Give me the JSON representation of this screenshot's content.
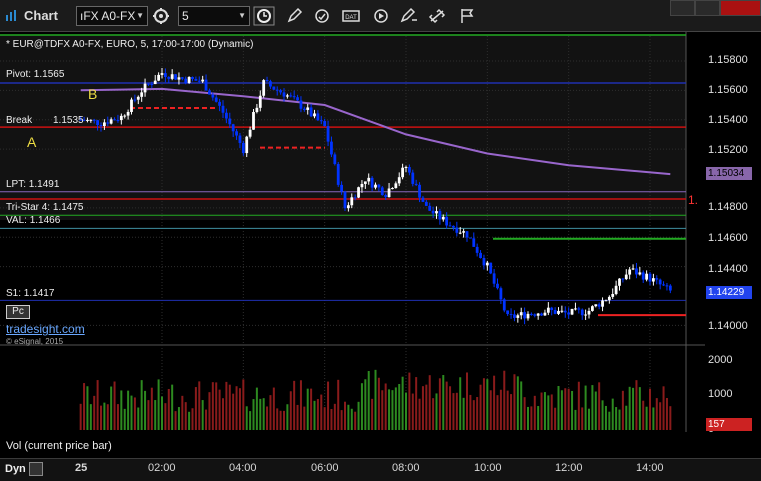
{
  "window": {
    "title": "Chart"
  },
  "toolbar": {
    "symbol": "ıFX A0-FX",
    "interval": "5"
  },
  "chart_header": "* EUR@TDFX A0-FX, EURO, 5, 17:00-17:00 (Dynamic)",
  "price_axis": {
    "ticks": [
      "1.15800",
      "1.15600",
      "1.15400",
      "1.15200",
      "1.14800",
      "1.14600",
      "1.14400",
      "1.14000"
    ]
  },
  "current_prices": {
    "ma_value": "1.15034",
    "last_price": "1.14229",
    "red_marker": "1.",
    "vol_marker": "157"
  },
  "volume_axis": {
    "ticks": [
      "2000",
      "1000",
      "0"
    ]
  },
  "levels": {
    "pivot": "Pivot: 1.1565",
    "break": "Break",
    "break_value": "1.1535",
    "lpt": "LPT: 1.1491",
    "tristar": "Tri-Star 4: 1.1475",
    "val": "VAL: 1.1466",
    "s1": "S1: 1.1417"
  },
  "point_labels": {
    "a": "A",
    "b": "B"
  },
  "time_axis": {
    "date": "25",
    "ticks": [
      "02:00",
      "04:00",
      "06:00",
      "08:00",
      "10:00",
      "12:00",
      "14:00"
    ]
  },
  "footer": {
    "dyn": "Dyn",
    "pc": "Pc"
  },
  "watermark": "tradesight.com",
  "copyright": "© eSignal, 2015",
  "volume_label": "Vol (current price bar)",
  "colors": {
    "up_bar": "#ffffff",
    "down_bar": "#0033ff",
    "moving_average": "#9966cc",
    "pivot_line": "#1f2fb0",
    "break_line": "#cc1111",
    "val_line": "#3f8fa0",
    "green_line": "#22aa22",
    "vol_up": "#2d8a20",
    "vol_down": "#8a1b1b"
  },
  "chart_data": {
    "type": "candlestick",
    "title": "* EUR@TDFX A0-FX, EURO, 5, 17:00-17:00 (Dynamic)",
    "xlabel": "",
    "ylabel": "",
    "x_ticks": [
      "02:00",
      "04:00",
      "06:00",
      "08:00",
      "10:00",
      "12:00",
      "14:00"
    ],
    "ylim": [
      1.1388,
      1.1597
    ],
    "price_anchors": [
      {
        "time": "00:00",
        "price": 1.154
      },
      {
        "time": "00:30",
        "price": 1.1538
      },
      {
        "time": "01:00",
        "price": 1.1542
      },
      {
        "time": "01:30",
        "price": 1.156
      },
      {
        "time": "02:00",
        "price": 1.1572
      },
      {
        "time": "02:30",
        "price": 1.1568
      },
      {
        "time": "03:00",
        "price": 1.1566
      },
      {
        "time": "03:30",
        "price": 1.1545
      },
      {
        "time": "04:00",
        "price": 1.152
      },
      {
        "time": "04:30",
        "price": 1.1565
      },
      {
        "time": "05:00",
        "price": 1.1558
      },
      {
        "time": "05:30",
        "price": 1.1548
      },
      {
        "time": "06:00",
        "price": 1.1535
      },
      {
        "time": "06:30",
        "price": 1.148
      },
      {
        "time": "07:00",
        "price": 1.15
      },
      {
        "time": "07:30",
        "price": 1.149
      },
      {
        "time": "08:00",
        "price": 1.1508
      },
      {
        "time": "08:30",
        "price": 1.148
      },
      {
        "time": "09:00",
        "price": 1.147
      },
      {
        "time": "09:30",
        "price": 1.1462
      },
      {
        "time": "10:00",
        "price": 1.144
      },
      {
        "time": "10:30",
        "price": 1.1405
      },
      {
        "time": "11:00",
        "price": 1.1408
      },
      {
        "time": "11:30",
        "price": 1.141
      },
      {
        "time": "12:00",
        "price": 1.1408
      },
      {
        "time": "12:30",
        "price": 1.141
      },
      {
        "time": "13:00",
        "price": 1.142
      },
      {
        "time": "13:30",
        "price": 1.1438
      },
      {
        "time": "14:00",
        "price": 1.1432
      },
      {
        "time": "14:30",
        "price": 1.1423
      }
    ],
    "moving_average": [
      {
        "time": "00:00",
        "price": 1.156
      },
      {
        "time": "02:00",
        "price": 1.1561
      },
      {
        "time": "04:00",
        "price": 1.1556
      },
      {
        "time": "06:00",
        "price": 1.155
      },
      {
        "time": "08:00",
        "price": 1.153
      },
      {
        "time": "10:00",
        "price": 1.1517
      },
      {
        "time": "12:00",
        "price": 1.1509
      },
      {
        "time": "14:30",
        "price": 1.1503
      }
    ],
    "levels": [
      {
        "name": "Pivot",
        "value": 1.1565
      },
      {
        "name": "Break",
        "value": 1.1535
      },
      {
        "name": "LPT",
        "value": 1.1491
      },
      {
        "name": "Tri-Star 4",
        "value": 1.1475
      },
      {
        "name": "VAL",
        "value": 1.1466
      },
      {
        "name": "S1",
        "value": 1.1417
      }
    ],
    "volume": {
      "ylim": [
        0,
        2200
      ],
      "typical_range": [
        200,
        1800
      ]
    }
  }
}
